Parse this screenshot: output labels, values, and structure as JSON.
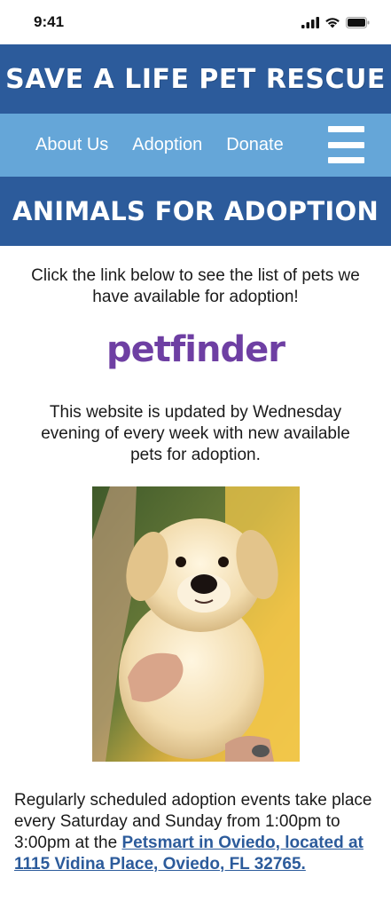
{
  "status_bar": {
    "time": "9:41",
    "icons": [
      "signal-icon",
      "wifi-icon",
      "battery-icon"
    ]
  },
  "header": {
    "title": "SAVE A LIFE PET RESCUE",
    "color": "#2c5b9b"
  },
  "nav": {
    "items": [
      {
        "label": "About Us"
      },
      {
        "label": "Adoption"
      },
      {
        "label": "Donate"
      }
    ],
    "menu_icon": "hamburger-menu-icon",
    "color": "#65a6d8"
  },
  "section": {
    "title": "ANIMALS FOR ADOPTION"
  },
  "main": {
    "intro": "Click the link below to see the list of pets we have available for adoption!",
    "logo_text": "petfinder",
    "logo_color": "#6e3fa3",
    "update_note": "This website is updated by Wednesday evening of every week with new available pets for adoption.",
    "events_text": "Regularly scheduled adoption events take place every Saturday and Sunday from 1:00pm to 3:00pm at the ",
    "events_link": "Petsmart in Oviedo, located at 1115 Vidina Place, Oviedo, FL 32765."
  }
}
